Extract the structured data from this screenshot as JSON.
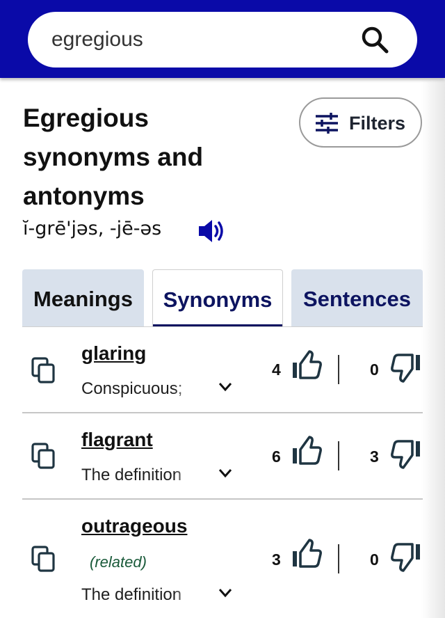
{
  "search": {
    "value": "egregious",
    "placeholder": ""
  },
  "header": {
    "title": "Egregious synonyms and antonyms",
    "pronunciation": "ĭ-grē'jəs, -jē-əs"
  },
  "filters": {
    "label": "Filters"
  },
  "tabs": [
    {
      "label": "Meanings",
      "active": false
    },
    {
      "label": "Synonyms",
      "active": true
    },
    {
      "label": "Sentences",
      "active": false
    }
  ],
  "synonyms": [
    {
      "word": "glaring",
      "tag": "",
      "definition": "Conspicuous;",
      "upvotes": "4",
      "downvotes": "0"
    },
    {
      "word": "flagrant",
      "tag": "",
      "definition": "The definition",
      "upvotes": "6",
      "downvotes": "3"
    },
    {
      "word": "outrageous",
      "tag": "(related)",
      "definition": "The definition",
      "upvotes": "3",
      "downvotes": "0"
    }
  ],
  "colors": {
    "topbar": "#0a0aa8",
    "tab_inactive_bg": "#d9e1ec",
    "tab_active_text": "#0d1460",
    "related_text": "#1a5a3a"
  },
  "icons": {
    "search": "magnifier-icon",
    "speaker": "speaker-icon",
    "filters": "sliders-icon",
    "copy": "copy-icon",
    "expand": "chevron-down-icon",
    "upvote": "thumbs-up-icon",
    "downvote": "thumbs-down-icon"
  }
}
